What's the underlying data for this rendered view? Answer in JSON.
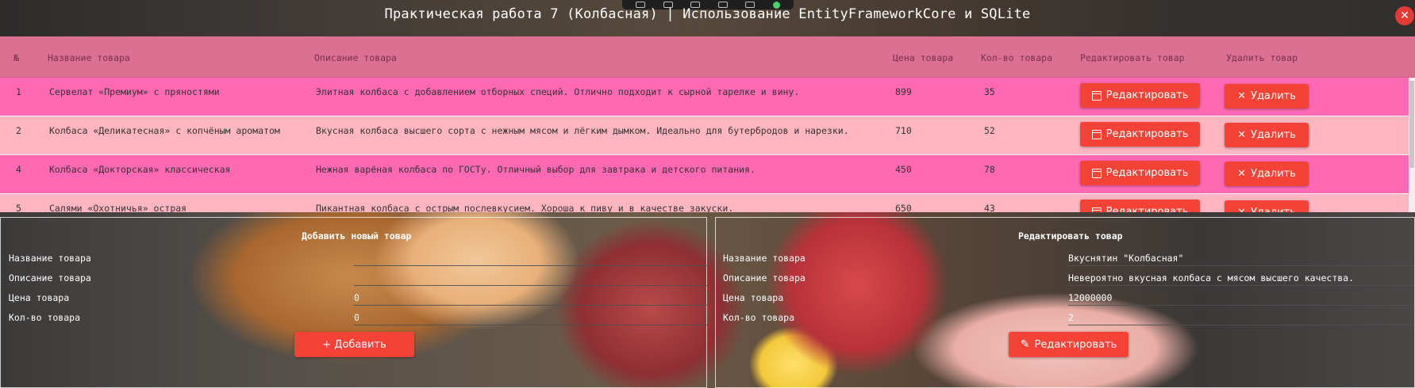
{
  "window": {
    "title": "Практическая работа 7 (Колбасная) | Использование EntityFrameworkCore и SQLite",
    "close_glyph": "✕"
  },
  "grid": {
    "columns": [
      "№",
      "Название товара",
      "Описание товара",
      "Цена товара",
      "Кол-во товара",
      "Редактировать товар",
      "Удалить товар"
    ],
    "rows": [
      {
        "id": "1",
        "name": "Сервелат «Премиум» с пряностями",
        "description": "Элитная колбаса с добавлением отборных специй. Отлично подходит к сырной тарелке и вину.",
        "price": "899",
        "qty": "35"
      },
      {
        "id": "2",
        "name": "Колбаса «Деликатесная» с копчёным ароматом",
        "description": "Вкусная колбаса высшего сорта с нежным мясом и лёгким дымком. Идеально для бутербродов и нарезки.",
        "price": "710",
        "qty": "52"
      },
      {
        "id": "4",
        "name": "Колбаса «Докторская» классическая",
        "description": "Нежная варёная колбаса по ГОСТу. Отличный выбор для завтрака и детского питания.",
        "price": "450",
        "qty": "78"
      },
      {
        "id": "5",
        "name": "Салями «Охотничья» острая",
        "description": "Пикантная колбаса с острым послевкусием. Хороша к пиву и в качестве закуски.",
        "price": "650",
        "qty": "43"
      }
    ],
    "edit_label": "Редактировать",
    "delete_label": "Удалить"
  },
  "add_form": {
    "title": "Добавить новый товар",
    "labels": {
      "name": "Название товара",
      "description": "Описание товара",
      "price": "Цена товара",
      "qty": "Кол-во товара"
    },
    "values": {
      "name": "",
      "description": "",
      "price": "0",
      "qty": "0"
    },
    "button_label": "+ Добавить"
  },
  "edit_form": {
    "title": "Редактировать товар",
    "labels": {
      "name": "Название товара",
      "description": "Описание товара",
      "price": "Цена товара",
      "qty": "Кол-во товара"
    },
    "values": {
      "name": "Вкуснятин \"Колбасная\"",
      "description": "Невероятно вкусная колбаса с мясом высшего качества.",
      "price": "12000000",
      "qty": "2"
    },
    "button_label": "Редактировать"
  },
  "colors": {
    "header": "#db7093",
    "row_odd": "#ff69b4",
    "row_even": "#ffb6c1",
    "button": "#f44336"
  }
}
